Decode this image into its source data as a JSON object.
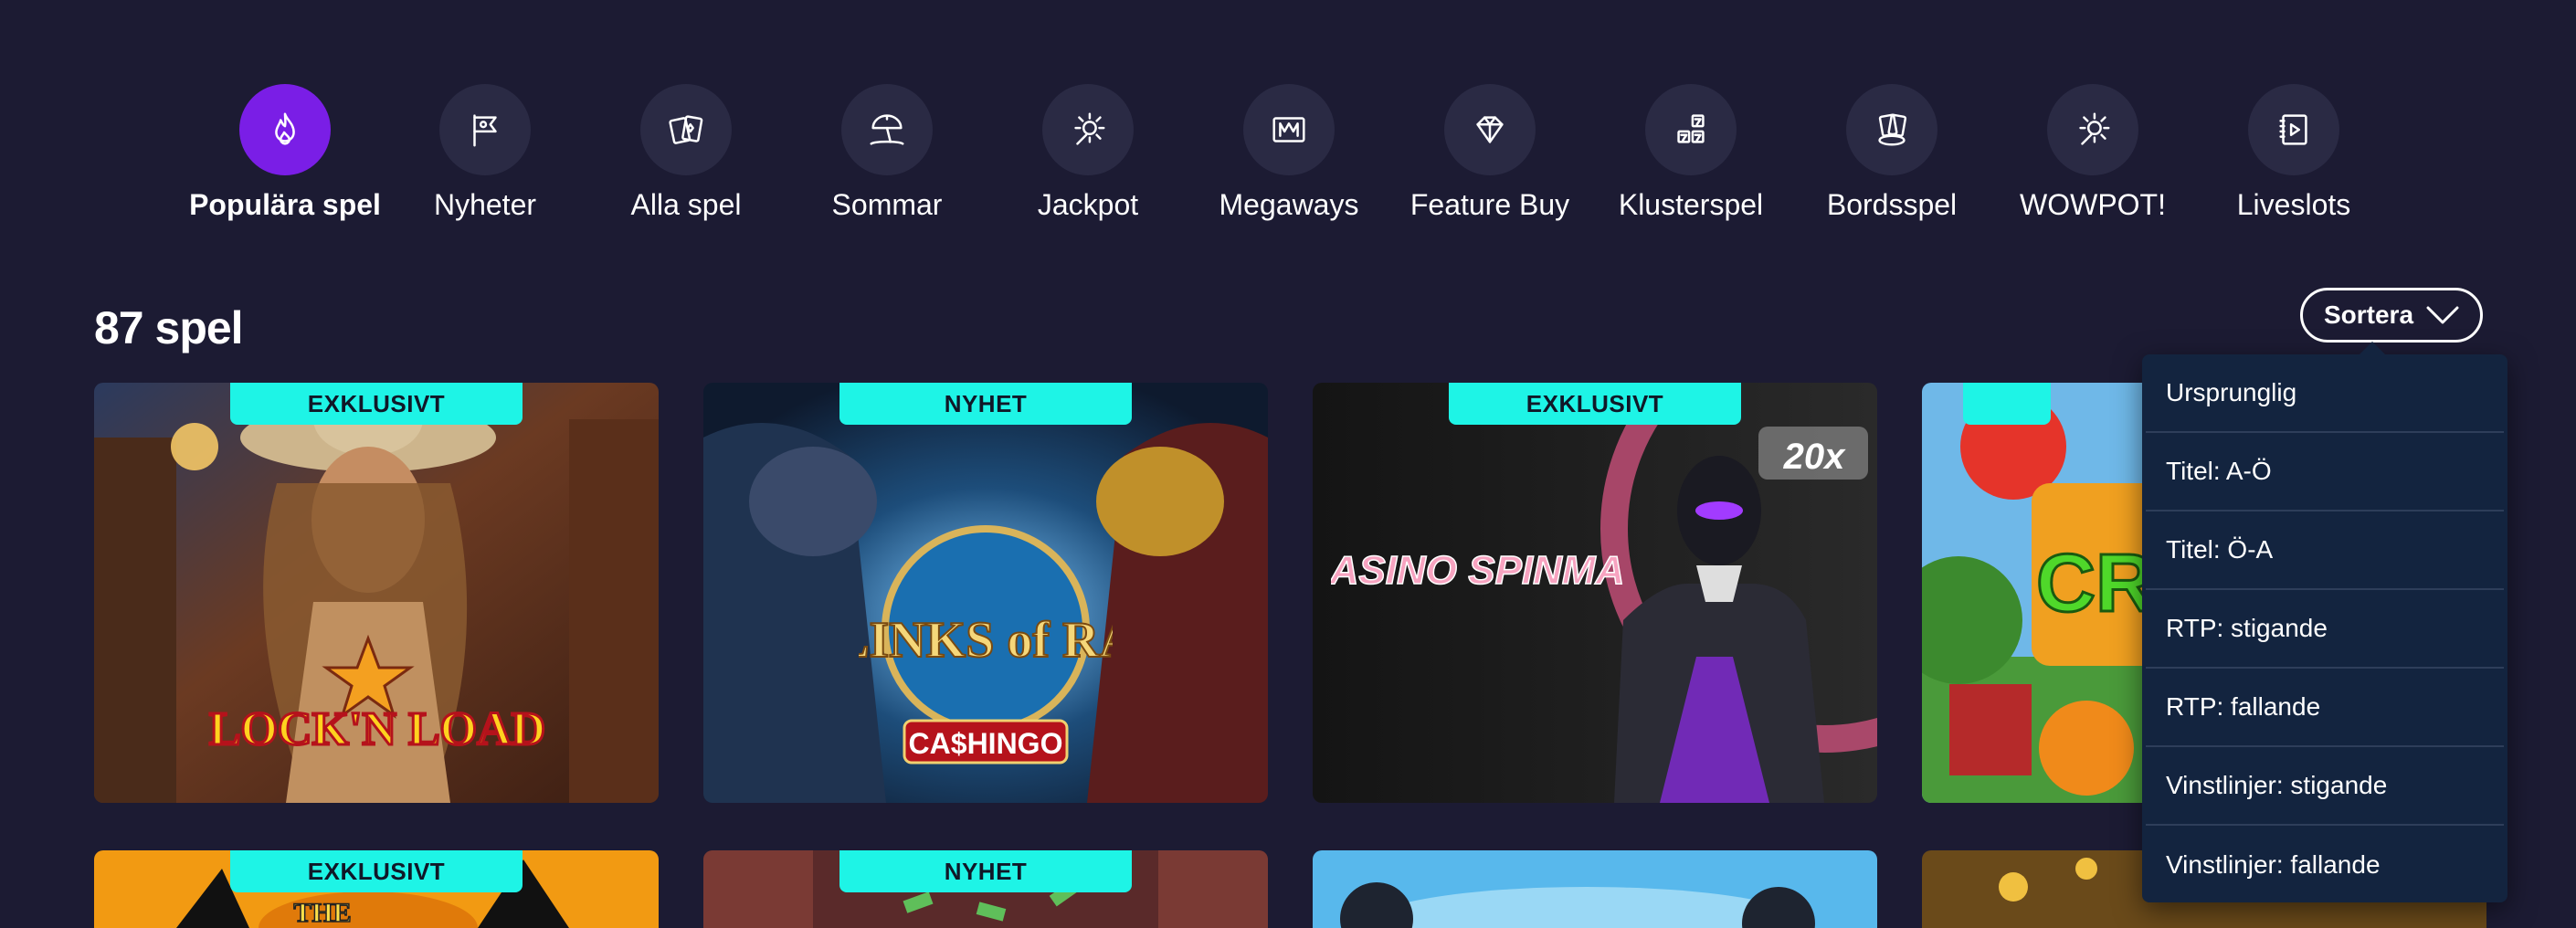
{
  "categories": [
    {
      "label": "Populära spel",
      "icon": "flame-icon",
      "active": true
    },
    {
      "label": "Nyheter",
      "icon": "flag-icon"
    },
    {
      "label": "Alla spel",
      "icon": "cards-icon"
    },
    {
      "label": "Sommar",
      "icon": "beach-umbrella-icon"
    },
    {
      "label": "Jackpot",
      "icon": "jackpot-burst-icon"
    },
    {
      "label": "Megaways",
      "icon": "megaways-icon"
    },
    {
      "label": "Feature Buy",
      "icon": "diamond-icon"
    },
    {
      "label": "Klusterspel",
      "icon": "cluster-blocks-icon"
    },
    {
      "label": "Bordsspel",
      "icon": "table-cards-icon"
    },
    {
      "label": "WOWPOT!",
      "icon": "wowpot-burst-icon"
    },
    {
      "label": "Liveslots",
      "icon": "live-play-icon"
    }
  ],
  "games_count": "87 spel",
  "sort": {
    "label": "Sortera",
    "options": [
      "Ursprunglig",
      "Titel: A-Ö",
      "Titel: Ö-A",
      "RTP: stigande",
      "RTP: fallande",
      "Vinstlinjer: stigande",
      "Vinstlinjer: fallande"
    ]
  },
  "games": [
    {
      "title": "LOCK'N LOAD",
      "badge": "EXKLUSIVT"
    },
    {
      "title": "LINKS of RA",
      "subtitle": "CA$HINGO",
      "badge": "NYHET"
    },
    {
      "title": "CASINO SPINMAN",
      "subtitle": "20x",
      "badge": "EXKLUSIVT"
    },
    {
      "title": "CR",
      "badge": ""
    },
    {
      "title": "THE",
      "badge": "EXKLUSIVT"
    },
    {
      "title": "",
      "badge": "NYHET"
    },
    {
      "title": "",
      "badge": ""
    },
    {
      "title": "",
      "badge": ""
    }
  ],
  "colors": {
    "background": "#1c1b33",
    "accent": "#7a1ee6",
    "badge": "#1ef4e6",
    "dropdown": "#13243f"
  }
}
